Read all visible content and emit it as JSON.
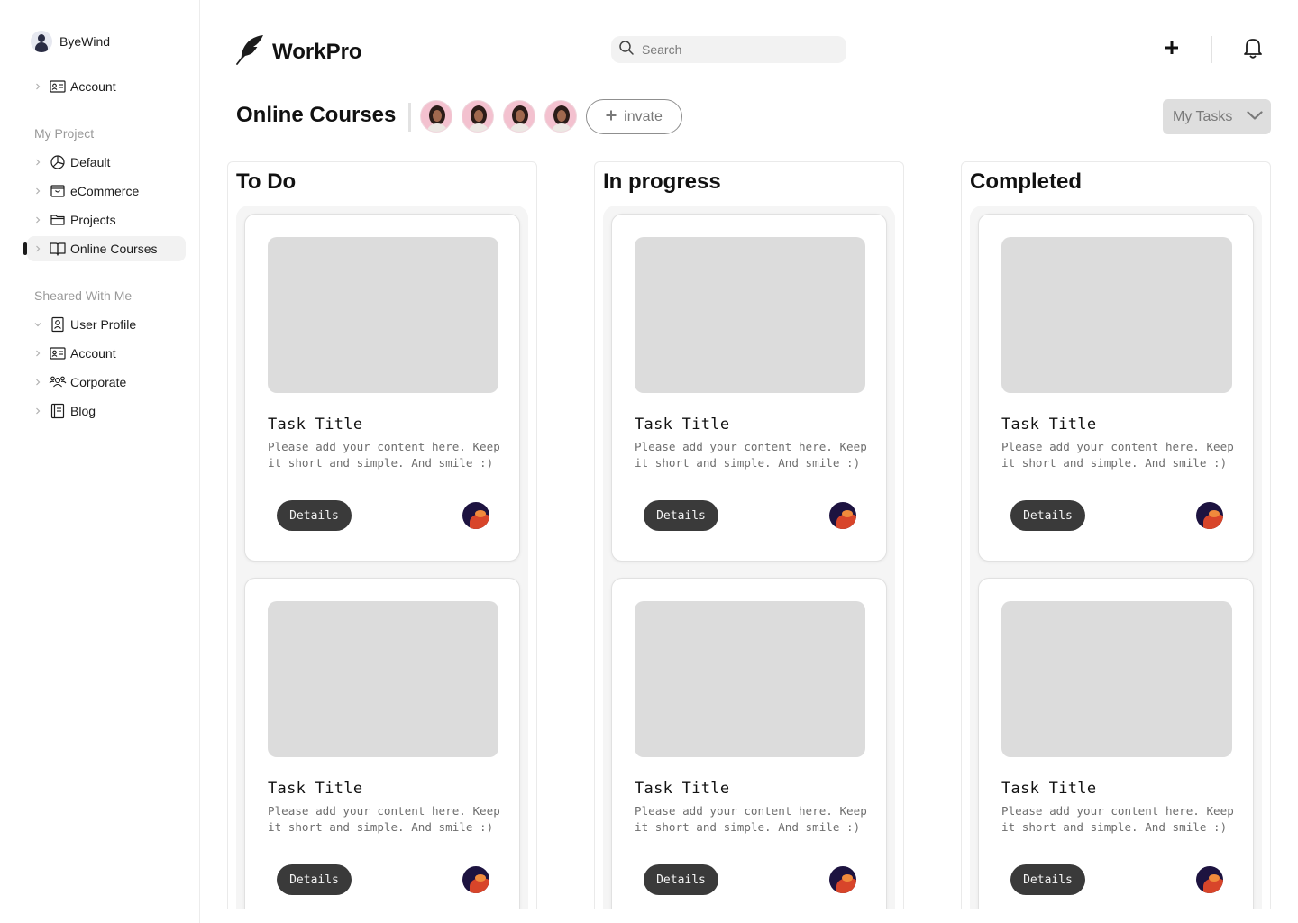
{
  "sidebar": {
    "user_name": "ByeWind",
    "top_items": [
      {
        "label": "Account",
        "icon": "id-card-icon"
      }
    ],
    "project_section": "My Project",
    "project_items": [
      {
        "label": "Default",
        "icon": "pie-chart-icon"
      },
      {
        "label": "eCommerce",
        "icon": "shopping-bag-icon"
      },
      {
        "label": "Projects",
        "icon": "folder-icon"
      },
      {
        "label": "Online Courses",
        "icon": "book-open-icon",
        "active": true
      }
    ],
    "shared_section": "Sheared With Me",
    "shared_items": [
      {
        "label": "User Profile",
        "icon": "user-badge-icon",
        "expanded": true
      },
      {
        "label": "Account",
        "icon": "id-card-icon"
      },
      {
        "label": "Corporate",
        "icon": "users-three-icon"
      },
      {
        "label": "Blog",
        "icon": "notebook-icon"
      }
    ]
  },
  "header": {
    "logo": "WorkPro",
    "search_placeholder": "Search"
  },
  "project": {
    "title": "Online Courses",
    "member_count": 4,
    "invite_label": "invate",
    "filter_label": "My Tasks"
  },
  "columns": [
    {
      "title": "To Do"
    },
    {
      "title": "In progress"
    },
    {
      "title": "Completed"
    }
  ],
  "cards": [
    {
      "title": "Task Title",
      "description": "Please add your content here. Keep it short and simple. And smile :)",
      "button": "Details"
    },
    {
      "title": "Task Title",
      "description": "Please add your content here. Keep it short and simple. And smile :)",
      "button": "Details"
    },
    {
      "title": "Task Title",
      "description": "Please add your content here. Keep it short and simple. And smile :)",
      "button": "Details"
    },
    {
      "title": "Task Title",
      "description": "Please add your content here. Keep it short and simple. And smile :)",
      "button": "Details"
    },
    {
      "title": "Task Title",
      "description": "Please add your content here. Keep it short and simple. And smile :)",
      "button": "Details"
    },
    {
      "title": "Task Title",
      "description": "Please add your content here. Keep it short and simple. And smile :)",
      "button": "Details"
    }
  ]
}
